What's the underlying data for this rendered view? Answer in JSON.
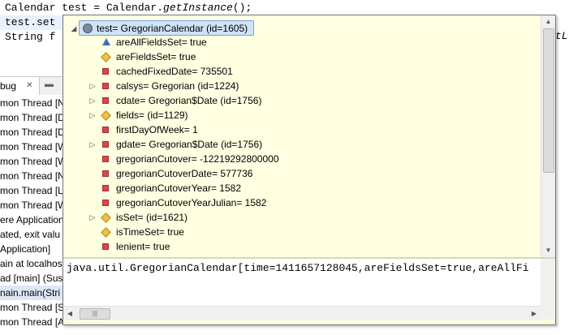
{
  "editor": {
    "lines": [
      {
        "text_a": "Calendar test = Calendar.",
        "text_italic": "getInstance",
        "text_b": "();"
      },
      {
        "text_a": "test.set",
        "text_italic": "",
        "text_b": ""
      },
      {
        "text_a": "String f",
        "text_italic": "",
        "text_b": ""
      }
    ],
    "overflow_right": "tL"
  },
  "debug_view": {
    "tab_label": "bug",
    "rows": [
      "mon Thread [N",
      "mon Thread [D",
      "mon Thread [D",
      "mon Thread [W",
      "mon Thread [W",
      "mon Thread [N",
      "mon Thread [L",
      "mon Thread [W",
      "ere Application",
      "ated, exit valu",
      "Application]",
      "ain at localhos",
      "ad [main] (Sus",
      "nain.main(Stri",
      "mon Thread [S",
      "mon Thread [A"
    ],
    "selected_row": 13
  },
  "popup": {
    "root": {
      "label": "test= GregorianCalendar  (id=1605)",
      "icon": "object-icon",
      "expanded": true
    },
    "fields": [
      {
        "label": "areAllFieldsSet= true",
        "icon": "public-field-icon",
        "expandable": false
      },
      {
        "label": "areFieldsSet= true",
        "icon": "protected-field-icon",
        "expandable": false
      },
      {
        "label": "cachedFixedDate= 735501",
        "icon": "private-field-icon",
        "expandable": false
      },
      {
        "label": "calsys= Gregorian  (id=1224)",
        "icon": "private-field-icon",
        "expandable": true
      },
      {
        "label": "cdate= Gregorian$Date  (id=1756)",
        "icon": "private-field-icon",
        "expandable": true
      },
      {
        "label": "fields=  (id=1129)",
        "icon": "protected-field-icon",
        "expandable": true
      },
      {
        "label": "firstDayOfWeek= 1",
        "icon": "private-field-icon",
        "expandable": false
      },
      {
        "label": "gdate= Gregorian$Date  (id=1756)",
        "icon": "private-field-icon",
        "expandable": true
      },
      {
        "label": "gregorianCutover= -12219292800000",
        "icon": "private-field-icon",
        "expandable": false
      },
      {
        "label": "gregorianCutoverDate= 577736",
        "icon": "private-field-icon",
        "expandable": false
      },
      {
        "label": "gregorianCutoverYear= 1582",
        "icon": "private-field-icon",
        "expandable": false
      },
      {
        "label": "gregorianCutoverYearJulian= 1582",
        "icon": "private-field-icon",
        "expandable": false
      },
      {
        "label": "isSet=  (id=1621)",
        "icon": "protected-field-icon",
        "expandable": true
      },
      {
        "label": "isTimeSet= true",
        "icon": "protected-field-icon",
        "expandable": false
      },
      {
        "label": "lenient= true",
        "icon": "private-field-icon",
        "expandable": false
      }
    ],
    "detail_text": "java.util.GregorianCalendar[time=1411657128045,areFieldsSet=true,areAllFi"
  },
  "colors": {
    "tooltip_bg": "#ffffe1",
    "private_field": "#d34a4a",
    "protected_field": "#f0c040",
    "public_field": "#3a6fc0",
    "selection": "#cfe3f8"
  }
}
